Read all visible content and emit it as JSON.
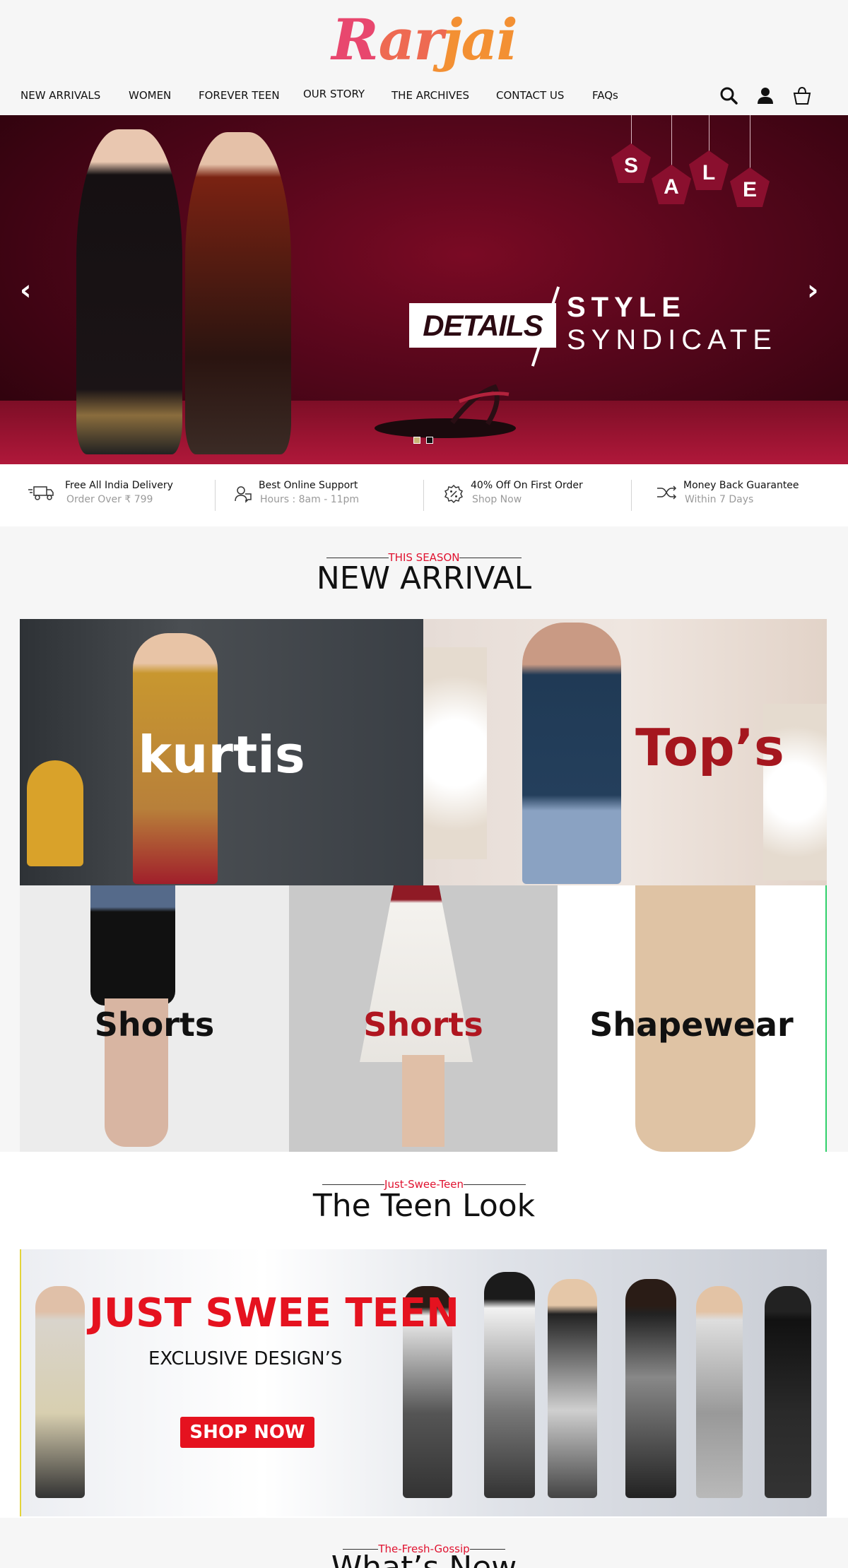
{
  "brand": {
    "logo_r": "R",
    "logo_a": "ar",
    "logo_j": "jai"
  },
  "nav": {
    "items": [
      "NEW ARRIVALS",
      "WOMEN",
      "FOREVER TEEN",
      "OUR STORY",
      "THE ARCHIVES",
      "CONTACT US",
      "FAQs"
    ],
    "icons": [
      "search-icon",
      "user-icon",
      "cart-icon"
    ]
  },
  "hero": {
    "sale_letters": [
      "S",
      "A",
      "L",
      "E"
    ],
    "details": "DETAILS",
    "line1": "STYLE",
    "line2": "SYNDICATE",
    "prev": "‹",
    "next": "›",
    "slides_total": 2,
    "active_slide": 1
  },
  "features": [
    {
      "title": "Free All India Delivery",
      "sub": "Order Over  ₹ 799",
      "icon": "truck-icon"
    },
    {
      "title": "Best Online Support",
      "sub": "Hours : 8am - 11pm",
      "icon": "support-icon"
    },
    {
      "title": "40% Off On First Order",
      "sub": "Shop Now",
      "icon": "discount-icon"
    },
    {
      "title": "Money Back Guarantee",
      "sub": "Within 7 Days",
      "icon": "shuffle-icon"
    }
  ],
  "new_arrival": {
    "kicker": "THIS SEASON",
    "title": "NEW ARRIVAL",
    "tiles": [
      "kurtis",
      "Top’s",
      "Shorts",
      "Shorts",
      "Shapewear"
    ]
  },
  "teen": {
    "kicker": "Just-Swee-Teen",
    "title": "The Teen Look",
    "banner_title": "JUST SWEE TEEN",
    "banner_sub": "EXCLUSIVE DESIGN’S",
    "cta": "SHOP NOW"
  },
  "gossip": {
    "kicker": "The-Fresh-Gossip",
    "title": "What’s New"
  },
  "colors": {
    "accent": "#e0122f",
    "hero_bg": "#52061a",
    "logo_pink": "#e8476e",
    "logo_orange": "#f39033"
  }
}
